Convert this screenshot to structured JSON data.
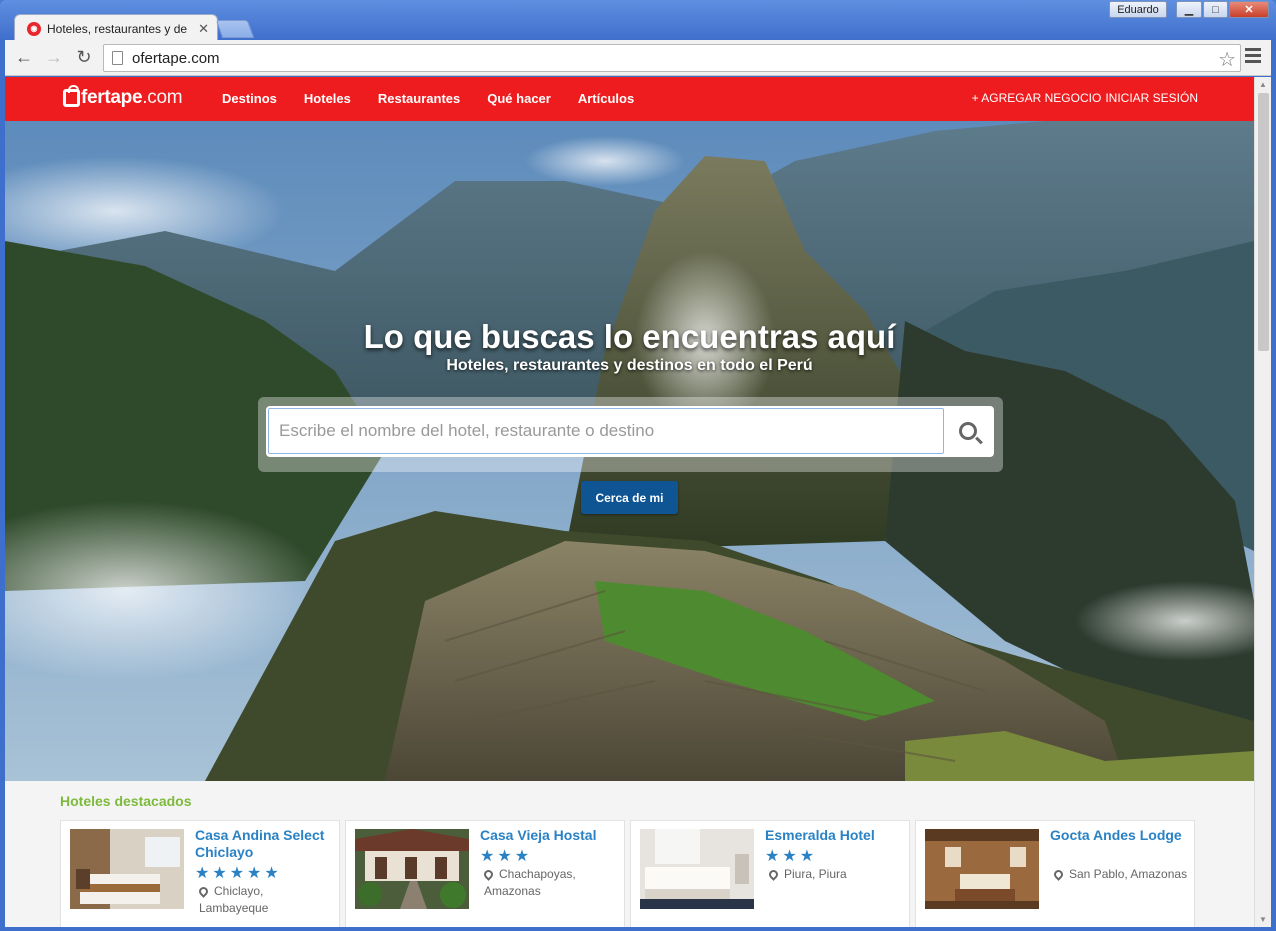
{
  "browser": {
    "tab_title": "Hoteles, restaurantes y de",
    "profile_name": "Eduardo",
    "url": "ofertape.com",
    "minimize": "▁",
    "maximize": "□",
    "close": "✕"
  },
  "site": {
    "logo_text": "fertape",
    "logo_domain": ".com",
    "nav": [
      "Destinos",
      "Hoteles",
      "Restaurantes",
      "Qué hacer",
      "Artículos"
    ],
    "add_business": "+ AGREGAR NEGOCIO",
    "login": "INICIAR SESIÓN",
    "colors": {
      "brand_red": "#ee1c1e",
      "link_blue": "#2a82c5",
      "section_green": "#7dba3c",
      "button_blue": "#0f5593"
    }
  },
  "hero": {
    "title": "Lo que buscas lo encuentras aquí",
    "subtitle": "Hoteles, restaurantes y destinos en todo el Perú",
    "search_placeholder": "Escribe el nombre del hotel, restaurante o destino",
    "search_value": "",
    "near_me": "Cerca de mi"
  },
  "featured": {
    "title": "Hoteles destacados",
    "hotels": [
      {
        "name": "Casa Andina Select Chiclayo",
        "stars": "★★★★★",
        "location": "Chiclayo, Lambayeque",
        "rating": 5
      },
      {
        "name": "Casa Vieja Hostal",
        "stars": "★★★",
        "location": "Chachapoyas, Amazonas",
        "rating": 3
      },
      {
        "name": "Esmeralda Hotel",
        "stars": "★★★",
        "location": "Piura, Piura",
        "rating": 3
      },
      {
        "name": "Gocta Andes Lodge",
        "stars": "",
        "location": "San Pablo, Amazonas",
        "rating": 0
      }
    ]
  }
}
